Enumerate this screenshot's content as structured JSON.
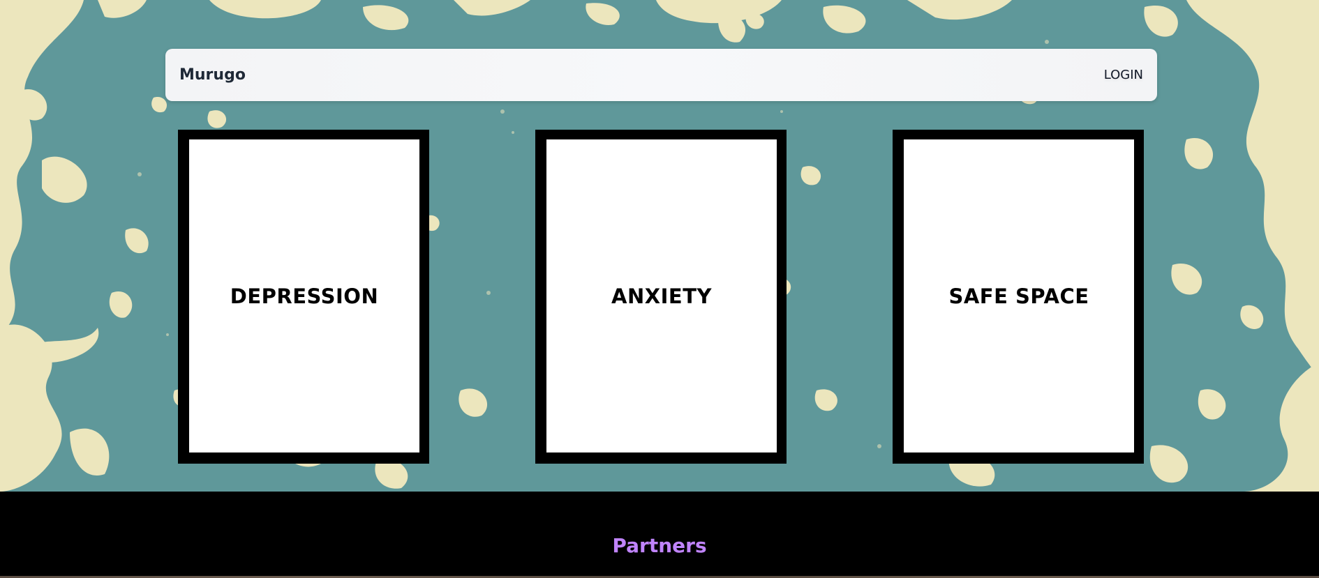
{
  "navbar": {
    "brand": "Murugo",
    "login_label": "LOGIN"
  },
  "cards": [
    {
      "title": "DEPRESSION"
    },
    {
      "title": "ANXIETY"
    },
    {
      "title": "SAFE SPACE"
    }
  ],
  "footer": {
    "partners_heading": "Partners"
  },
  "colors": {
    "hero_background": "#5f989a",
    "grunge_overlay": "#ece6bd",
    "card_frame": "#000000",
    "card_face": "#ffffff",
    "partners_heading": "#c084fc",
    "footer_background": "#000000"
  }
}
